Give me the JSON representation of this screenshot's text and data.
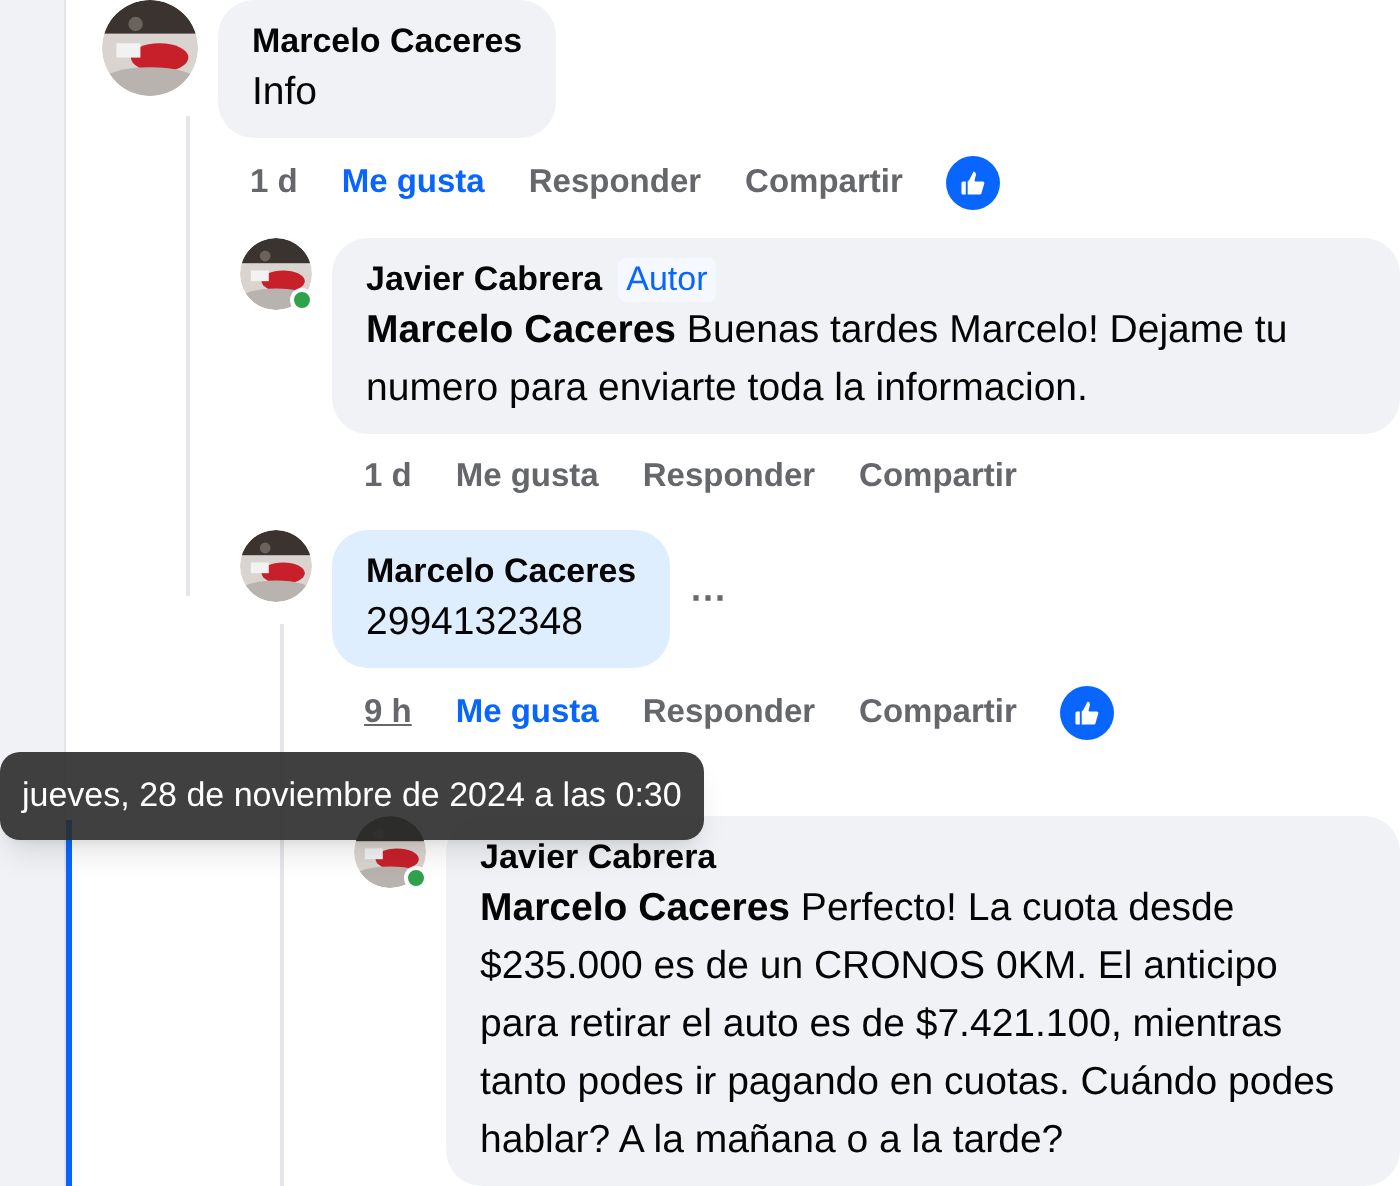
{
  "comments": [
    {
      "author": "Marcelo Caceres",
      "text": "Info",
      "time": "1 d",
      "highlighted": false,
      "online": false,
      "liked": true,
      "reacted": true,
      "time_hovered": false,
      "actions": [
        "Me gusta",
        "Responder",
        "Compartir"
      ],
      "children": [
        {
          "author": "Javier Cabrera",
          "badge": "Autor",
          "text": "**Marcelo Caceres** Buenas tardes Marcelo! Dejame tu numero para enviarte toda la informacion.",
          "time": "1 d",
          "highlighted": false,
          "online": true,
          "liked": false,
          "reacted": false,
          "time_hovered": false,
          "actions": [
            "Me gusta",
            "Responder",
            "Compartir"
          ]
        },
        {
          "author": "Marcelo Caceres",
          "text": "2994132348",
          "more_icon": "⋯",
          "time": "9 h",
          "highlighted": true,
          "online": false,
          "liked": true,
          "reacted": true,
          "time_hovered": true,
          "actions": [
            "Me gusta",
            "Responder",
            "Compartir"
          ],
          "children": [
            {
              "author": "Javier Cabrera",
              "text": "**Marcelo Caceres** Perfecto! La cuota desde $235.000 es de un CRONOS 0KM. El anticipo para retirar el auto es de $7.421.100, mientras tanto podes ir pagando en cuotas. Cuándo podes hablar? A la mañana o a la tarde?",
              "highlighted": false,
              "online": true
            }
          ]
        }
      ]
    }
  ],
  "tooltip": "jueves, 28 de noviembre de 2024 a las 0:30"
}
